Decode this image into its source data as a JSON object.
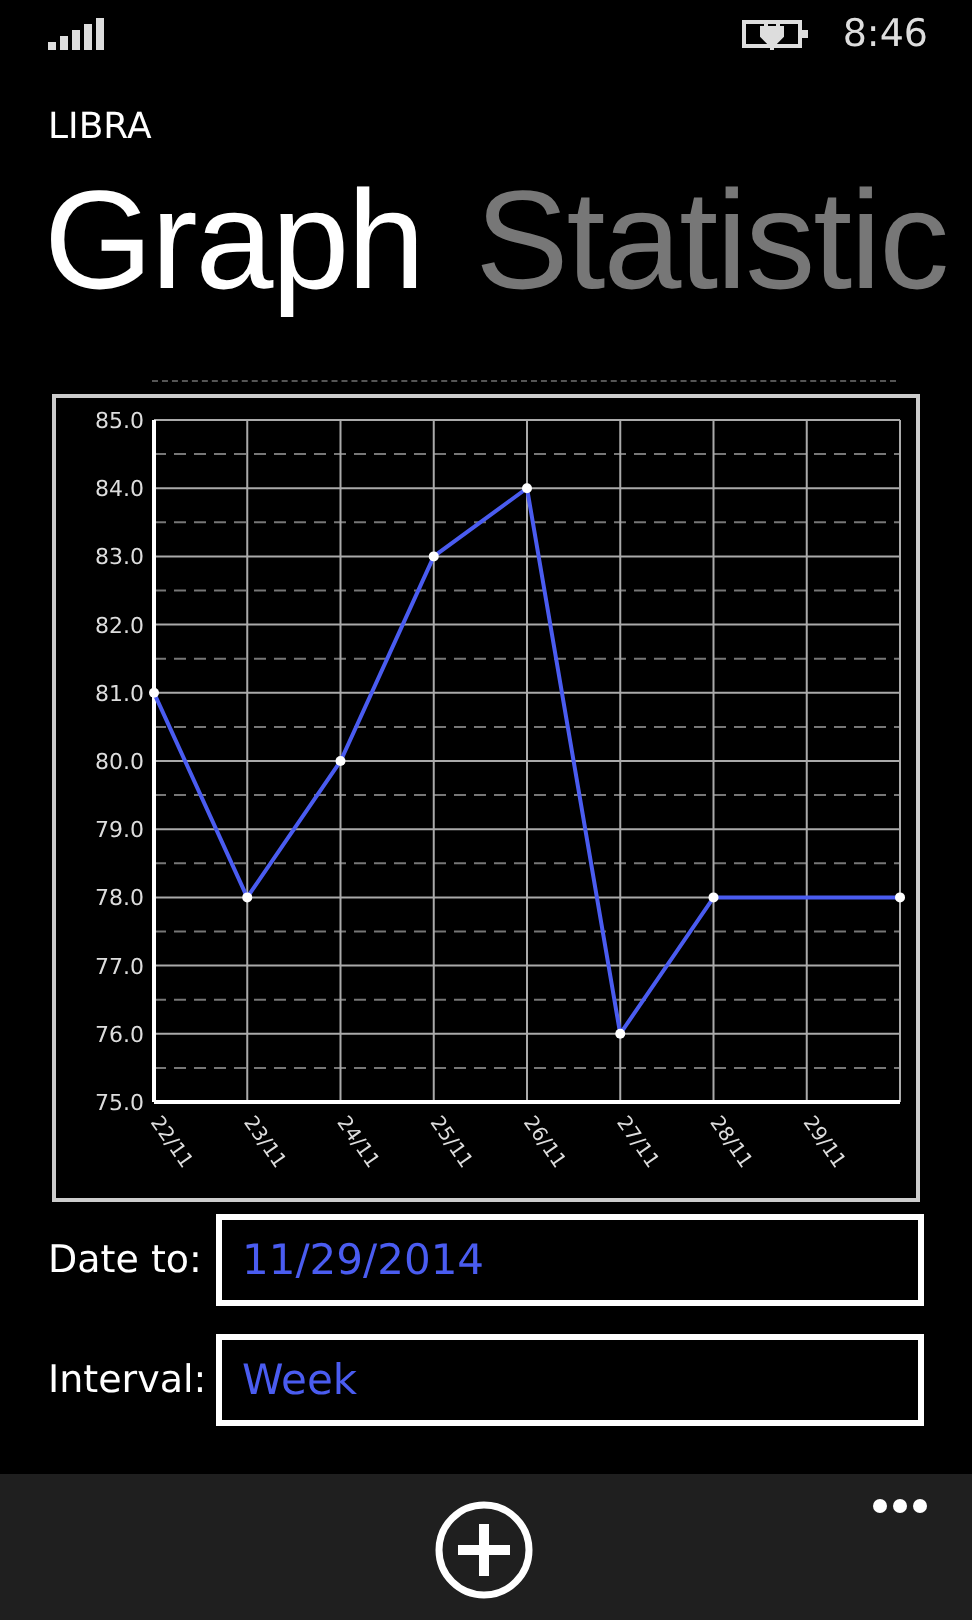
{
  "status_bar": {
    "time": "8:46"
  },
  "app_title": "LIBRA",
  "tabs": [
    {
      "label": "Graph",
      "selected": true
    },
    {
      "label": "Statistic",
      "selected": false
    }
  ],
  "chart_data": {
    "type": "line",
    "categories": [
      "22/11",
      "23/11",
      "24/11",
      "25/11",
      "26/11",
      "27/11",
      "28/11",
      "29/11",
      null
    ],
    "ylim": [
      75,
      85
    ],
    "grid": true,
    "yticks": [
      {
        "value": 75,
        "label": "75.0"
      },
      {
        "value": 76,
        "label": "76.0"
      },
      {
        "value": 77,
        "label": "77.0"
      },
      {
        "value": 78,
        "label": "78.0"
      },
      {
        "value": 79,
        "label": "79.0"
      },
      {
        "value": 80,
        "label": "80.0"
      },
      {
        "value": 81,
        "label": "81.0"
      },
      {
        "value": 82,
        "label": "82.0"
      },
      {
        "value": 83,
        "label": "83.0"
      },
      {
        "value": 84,
        "label": "84.0"
      },
      {
        "value": 85,
        "label": "85.0"
      }
    ],
    "series": [
      {
        "color": "#4a5cf0",
        "marker": true,
        "values": [
          81,
          78,
          80,
          83,
          84,
          76,
          78,
          null,
          78
        ]
      }
    ]
  },
  "fields": [
    {
      "label": "Date to:",
      "value": "11/29/2014"
    },
    {
      "label": "Interval:",
      "value": "Week"
    }
  ]
}
